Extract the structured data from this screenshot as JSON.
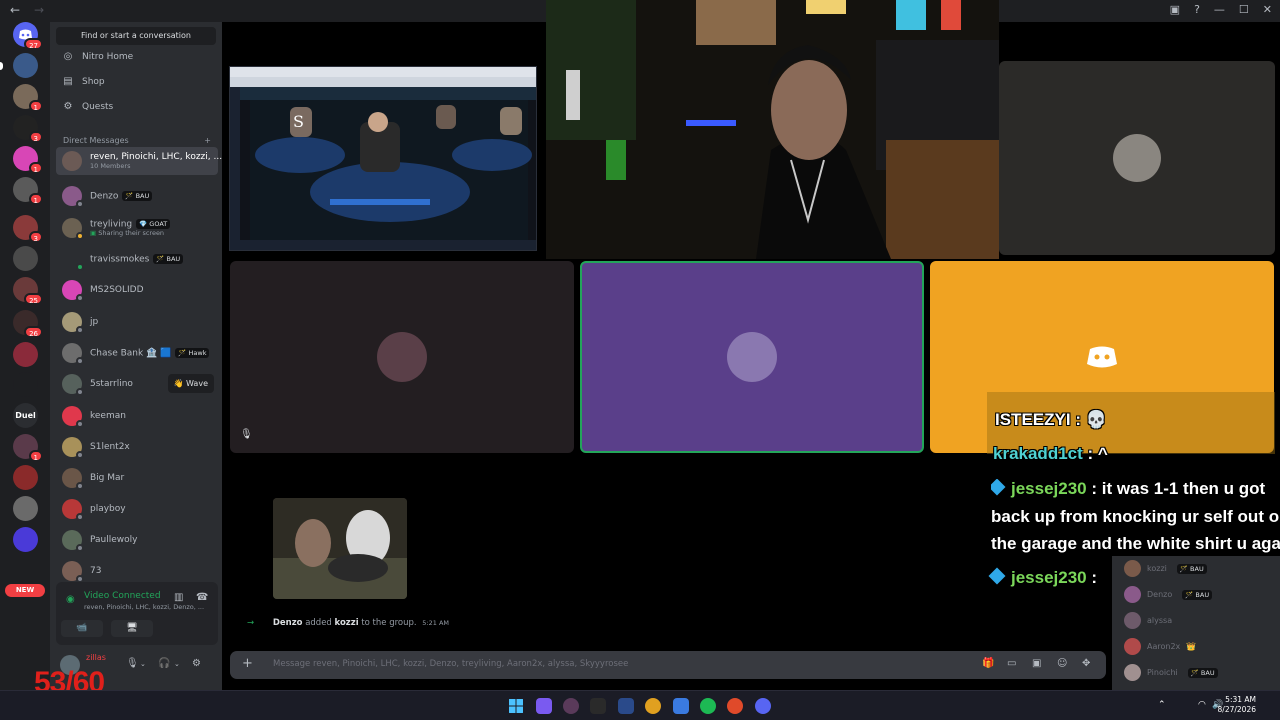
{
  "titlebar": {
    "back": "←",
    "forward": "→",
    "controls": [
      "▣",
      "?",
      "—",
      "☐",
      "✕"
    ]
  },
  "rail": {
    "home_badge": "27",
    "badges": [
      "1",
      "3",
      "1",
      "1",
      "3",
      "25",
      "26",
      "1"
    ],
    "duel_label": "Duel",
    "new_label": "NEW"
  },
  "sidebar": {
    "find_placeholder": "Find or start a conversation",
    "nav": [
      {
        "label": "Nitro Home",
        "icon": "nitro-icon"
      },
      {
        "label": "Shop",
        "icon": "shop-icon"
      },
      {
        "label": "Quests",
        "icon": "quests-icon"
      }
    ],
    "dm_header": "Direct Messages",
    "dm_add": "+",
    "dms": [
      {
        "name": "reven, Pinoichi, LHC, kozzi, ...",
        "sub": "10 Members",
        "color": "#6b5a55"
      },
      {
        "name": "Denzo",
        "tag": "🪄 BAU",
        "color": "#8a5a8a"
      },
      {
        "name": "treyliving",
        "tag": "💎 GOAT",
        "sub": "Sharing their screen",
        "color": "#6b6152"
      },
      {
        "name": "travissmokes",
        "tag": "🪄 BAU",
        "color": "#2b2d31"
      },
      {
        "name": "MS2SOLIDD",
        "color": "#d846b6"
      },
      {
        "name": "jp",
        "color": "#a59a78"
      },
      {
        "name": "Chase Bank 🏦 🟦",
        "tag": "🪄 Hawk",
        "color": "#6d6d6d"
      },
      {
        "name": "5starrlino",
        "color": "#56615c"
      },
      {
        "name": "keeman",
        "color": "#e0384c"
      },
      {
        "name": "S1lent2x",
        "color": "#a8915a"
      },
      {
        "name": "Big Mar",
        "color": "#6a5648"
      },
      {
        "name": "playboy",
        "color": "#b83838"
      },
      {
        "name": "Paullewoly",
        "color": "#5a6a5a"
      },
      {
        "name": "73",
        "color": "#7a5f55"
      }
    ],
    "wave_label": "👋 Wave"
  },
  "voice": {
    "status": "Video Connected",
    "members": "reven, Pinoichi, LHC, kozzi, Denzo, ...",
    "buttons": [
      "📹",
      "🖥",
      "✥",
      "🚀"
    ]
  },
  "user": {
    "name": "zillas",
    "fps": "53/60"
  },
  "chat": {
    "system_actor": "Denzo",
    "system_verb": "added",
    "system_target": "kozzi",
    "system_tail": "to the group.",
    "system_time": "5:21 AM",
    "composer_placeholder": "Message reven, Pinoichi, LHC, kozzi, Denzo, treyliving, Aaron2x, alyssa, Skyyyrosee"
  },
  "members": [
    {
      "name": "kozzi",
      "tag": "🪄 BAU",
      "color": "#7a5a4a"
    },
    {
      "name": "Denzo",
      "tag": "🪄 BAU",
      "color": "#8a5a8a"
    },
    {
      "name": "alyssa",
      "color": "#6d5a6a"
    },
    {
      "name": "Aaron2x",
      "tag": "👑",
      "color": "#b04a4a"
    },
    {
      "name": "Pinoichi",
      "tag": "🪄 BAU",
      "color": "#a09090"
    }
  ],
  "overlay": {
    "line1_user": "ISTEEZYI",
    "line1_sep": ":",
    "line1_msg": "💀",
    "line2_user": "krakadd1ct",
    "line2_sep": ":",
    "line2_msg": "^",
    "line3_user": "jessej230",
    "line3_sep": ":",
    "line3_msg": "it was 1-1 then u got",
    "line4": "back up from knocking ur self out o",
    "line5": "the garage and the white shirt u aga",
    "line6_user": "jessej230",
    "line6_sep": ":"
  },
  "colors": {
    "discord_blurple": "#5865f2",
    "status_green": "#23a55a",
    "badge_red": "#f23f43",
    "tile_purple": "#5a3f8a",
    "tile_orange": "#f0a322"
  },
  "taskbar": {
    "time": "5:31 AM",
    "date": "8/27/2026",
    "tray_up": "⌃"
  }
}
